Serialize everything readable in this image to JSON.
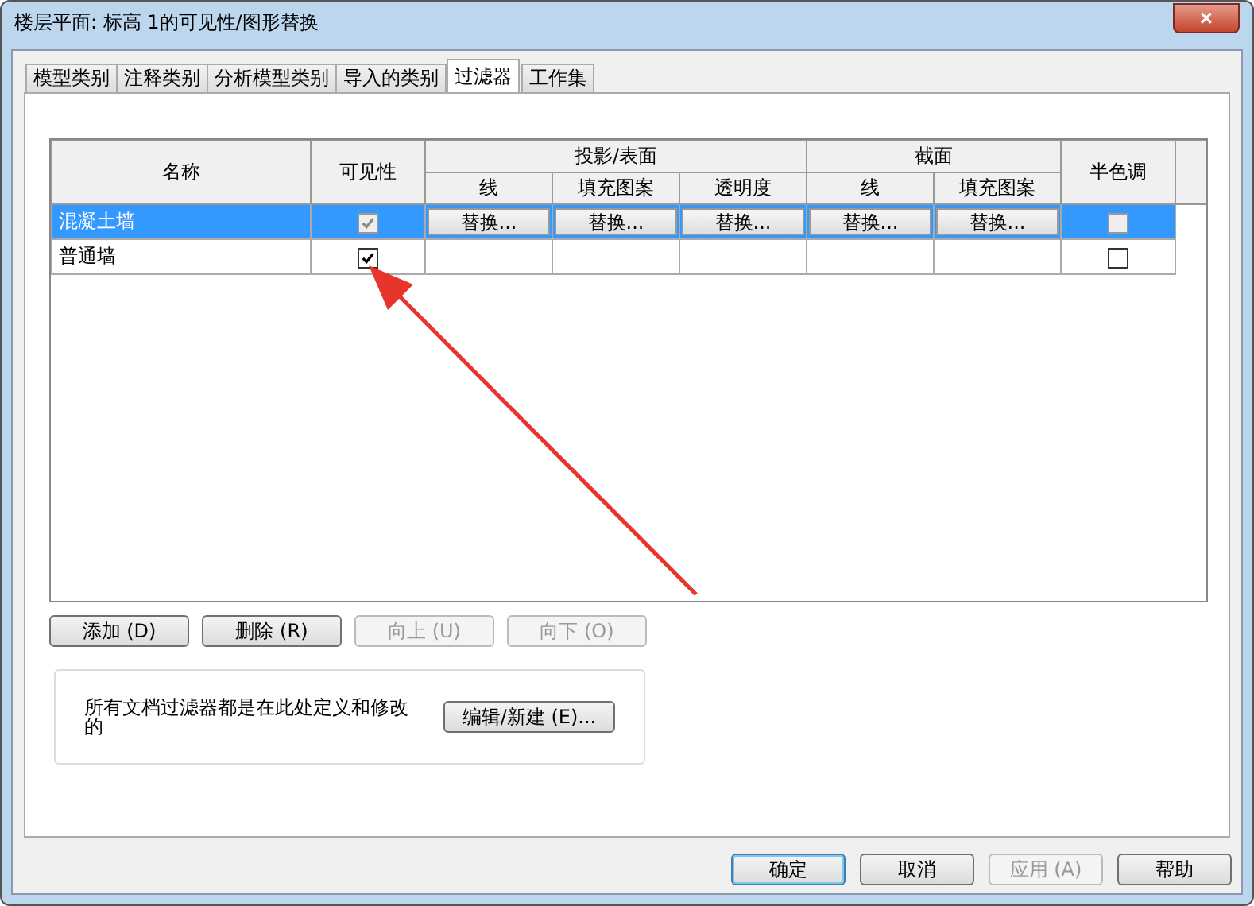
{
  "window": {
    "title": "楼层平面: 标高 1的可见性/图形替换",
    "close": "×"
  },
  "tabs": [
    {
      "label": "模型类别",
      "selected": false
    },
    {
      "label": "注释类别",
      "selected": false
    },
    {
      "label": "分析模型类别",
      "selected": false
    },
    {
      "label": "导入的类别",
      "selected": false
    },
    {
      "label": "过滤器",
      "selected": true
    },
    {
      "label": "工作集",
      "selected": false
    }
  ],
  "table": {
    "name_header": "名称",
    "visible_header": "可见性",
    "groups": [
      {
        "label": "投影/表面",
        "columns": [
          "线",
          "填充图案",
          "透明度"
        ]
      },
      {
        "label": "截面",
        "columns": [
          "线",
          "填充图案"
        ]
      }
    ],
    "halftone_header": "半色调",
    "rows": [
      {
        "name": "混凝土墙",
        "selected": true,
        "visible": true,
        "overrides": [
          "替换...",
          "替换...",
          "替换...",
          "替换...",
          "替换..."
        ],
        "halftone": false
      },
      {
        "name": "普通墙",
        "selected": false,
        "visible": true,
        "overrides": [],
        "halftone": false
      }
    ]
  },
  "row_buttons": [
    {
      "label": "添加 (D)",
      "disabled": false
    },
    {
      "label": "删除 (R)",
      "disabled": false
    },
    {
      "label": "向上 (U)",
      "disabled": true
    },
    {
      "label": "向下 (O)",
      "disabled": true
    }
  ],
  "info": {
    "text": "所有文档过滤器都是在此处定义和修改的",
    "button": "编辑/新建 (E)..."
  },
  "footer_buttons": [
    {
      "label": "确定",
      "disabled": false,
      "default": true
    },
    {
      "label": "取消",
      "disabled": false,
      "default": false
    },
    {
      "label": "应用 (A)",
      "disabled": true,
      "default": false
    },
    {
      "label": "帮助",
      "disabled": false,
      "default": false
    }
  ]
}
